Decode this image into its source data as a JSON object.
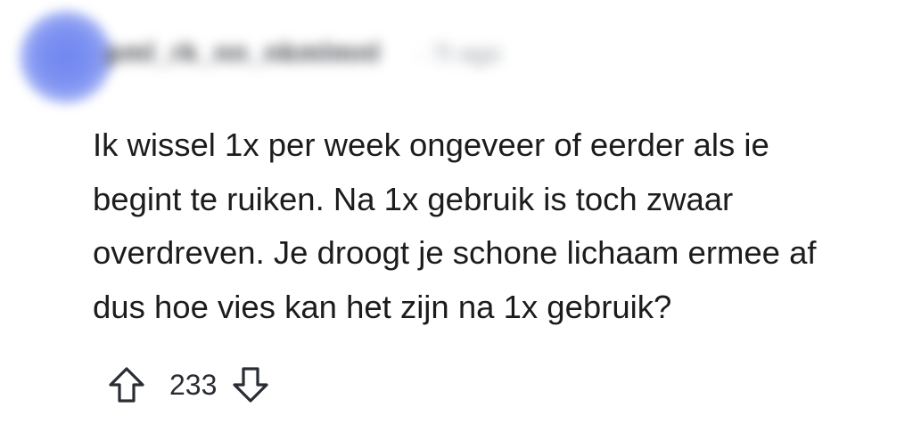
{
  "comment": {
    "author": "pml_rk_nn_nkmlmnl",
    "timestamp": "· 7t ago",
    "body_lines": [
      "Ik wissel 1x per week ongeveer of eerder als ie",
      "begint te ruiken. Na 1x gebruik is toch zwaar",
      "overdreven. Je droogt je schone lichaam ermee af",
      "dus hoe vies kan het zijn na 1x gebruik?"
    ],
    "score": "233"
  },
  "icons": {
    "upvote": "arrow-up-outline-icon",
    "downvote": "arrow-down-outline-icon"
  },
  "colors": {
    "avatar": "#7f93f2",
    "text": "#1c1c1c",
    "icon": "#2a2d33"
  }
}
